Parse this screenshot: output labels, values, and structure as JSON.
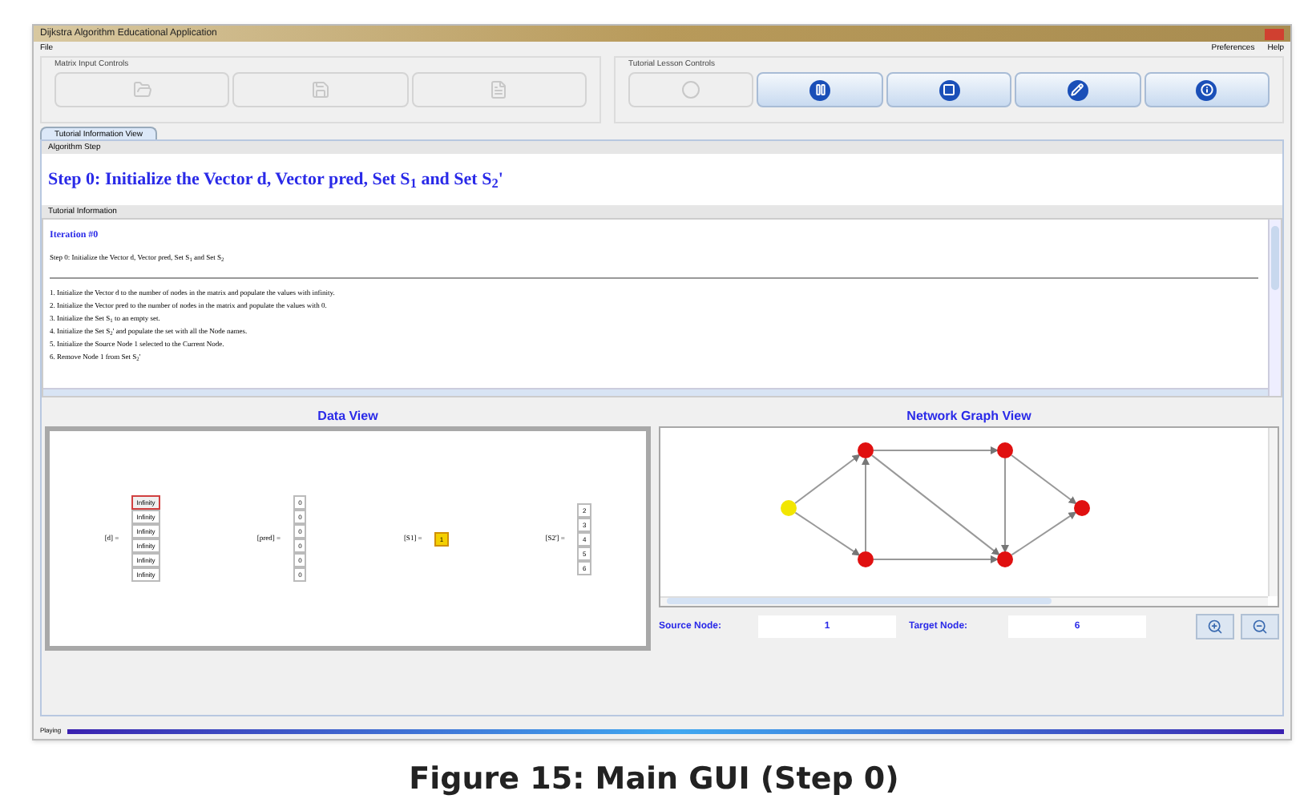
{
  "window": {
    "title": "Dijkstra Algorithm Educational Application"
  },
  "menu": {
    "left": [
      "File"
    ],
    "right": [
      "Preferences",
      "Help"
    ]
  },
  "matrix_controls": {
    "title": "Matrix Input Controls",
    "buttons": [
      {
        "kind": "open",
        "disabled": true
      },
      {
        "kind": "save",
        "disabled": true
      },
      {
        "kind": "export",
        "disabled": true
      }
    ]
  },
  "lesson_controls": {
    "title": "Tutorial Lesson Controls",
    "buttons": [
      {
        "kind": "play",
        "disabled": true
      },
      {
        "kind": "pause",
        "disabled": false
      },
      {
        "kind": "stop",
        "disabled": false
      },
      {
        "kind": "edit",
        "disabled": false
      },
      {
        "kind": "info",
        "disabled": false
      }
    ]
  },
  "tabs": [
    {
      "label": "Tutorial Information View",
      "selected": true
    }
  ],
  "algorithm_step": {
    "label": "Algorithm Step",
    "text": "Step 0: Initialize the Vector d, Vector pred, Set S$_{1}$ and Set S$_{2}$'"
  },
  "tutorial_information": {
    "label": "Tutorial Information",
    "heading": "Iteration #0",
    "summary": "Step 0: Initialize the Vector d, Vector pred, Set S$_{1}$ and Set S$_{2}$",
    "steps": [
      "1. Initialize the Vector d to the number of nodes in the matrix and populate the values with infinity.",
      "2. Initialize the Vector pred to the number of nodes in the matrix and populate the values with 0.",
      "3. Initialize the Set S$_{1}$ to an empty set.",
      "4. Initialize the Set S$_{2}$' and populate the set with all the Node names.",
      "5. Initialize the Source Node 1 selected to the Current Node.",
      "6. Remove Node 1 from Set S$_{2}$'"
    ]
  },
  "data_view": {
    "title": "Data View",
    "vectors": [
      {
        "label": "[d] =",
        "cells": [
          {
            "value": "Infinity",
            "selected": true
          },
          {
            "value": "Infinity",
            "selected": false
          },
          {
            "value": "Infinity",
            "selected": false
          },
          {
            "value": "Infinity",
            "selected": false
          },
          {
            "value": "Infinity",
            "selected": false
          },
          {
            "value": "Infinity",
            "selected": false
          }
        ]
      },
      {
        "label": "[pred] =",
        "cells": [
          {
            "value": "0",
            "selected": false
          },
          {
            "value": "0",
            "selected": false
          },
          {
            "value": "0",
            "selected": false
          },
          {
            "value": "0",
            "selected": false
          },
          {
            "value": "0",
            "selected": false
          },
          {
            "value": "0",
            "selected": false
          }
        ]
      },
      {
        "label": "[S1] =",
        "cells": [
          {
            "value": "1",
            "selected": true
          }
        ]
      },
      {
        "label": "[S2'] =",
        "cells": [
          {
            "value": "2",
            "selected": false
          },
          {
            "value": "3",
            "selected": false
          },
          {
            "value": "4",
            "selected": false
          },
          {
            "value": "5",
            "selected": false
          },
          {
            "value": "6",
            "selected": false
          }
        ]
      }
    ]
  },
  "graph_view": {
    "title": "Network Graph View",
    "nodes": [
      {
        "color": "#f2e600"
      },
      {
        "color": "#e01010"
      },
      {
        "color": "#e01010"
      },
      {
        "color": "#e01010"
      },
      {
        "color": "#e01010"
      },
      {
        "color": "#e01010"
      }
    ],
    "source_label": "Source Node:",
    "source_value": "1",
    "target_label": "Target Node:",
    "target_value": "6"
  },
  "status_bar": {
    "text": "Playing",
    "level": 1
  },
  "caption": "Figure 15: Main GUI (Step 0)"
}
